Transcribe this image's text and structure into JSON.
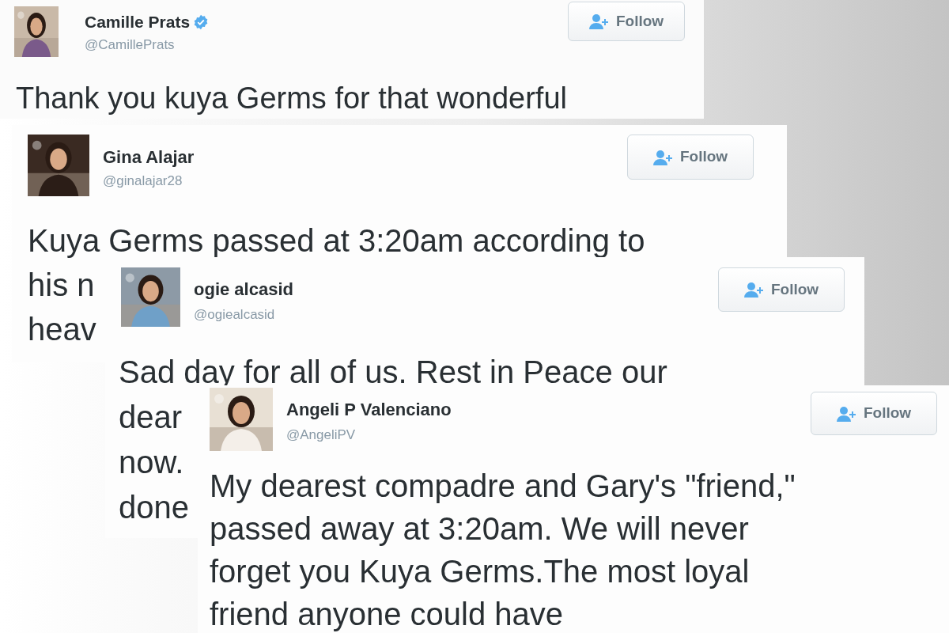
{
  "tweets": [
    {
      "name": "Camille Prats",
      "verified": true,
      "handle": "@CamillePrats",
      "follow": "Follow",
      "avatar": {
        "kind": "picture"
      },
      "lines": [
        "Thank you kuya Germs for that wonderful"
      ]
    },
    {
      "name": "Gina Alajar",
      "verified": false,
      "handle": "@ginalajar28",
      "follow": "Follow",
      "avatar": {
        "kind": "picture"
      },
      "lines": [
        "Kuya Germs passed at 3:20am according to",
        "his n",
        "heav"
      ]
    },
    {
      "name": "ogie alcasid",
      "verified": false,
      "handle": "@ogiealcasid",
      "follow": "Follow",
      "avatar": {
        "kind": "picture"
      },
      "lines": [
        "Sad day for all of us. Rest in Peace our",
        "dear",
        "now.",
        "done"
      ]
    },
    {
      "name": "Angeli P Valenciano",
      "verified": false,
      "handle": "@AngeliPV",
      "follow": "Follow",
      "avatar": {
        "kind": "picture"
      },
      "lines": [
        "My dearest compadre and Gary's \"friend,\"",
        "passed away at 3:20am. We will never",
        "forget you Kuya Germs.The most loyal",
        "friend anyone could have"
      ]
    }
  ]
}
